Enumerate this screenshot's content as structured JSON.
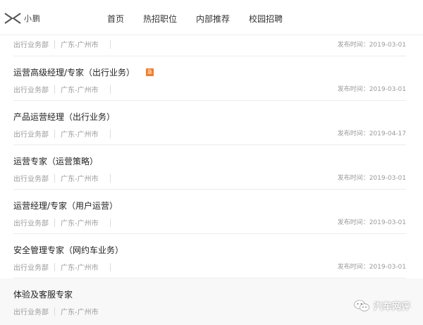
{
  "brand": {
    "name": "小鹏",
    "logo_icon": "xpeng-x-logo-icon"
  },
  "nav": [
    {
      "label": "首页"
    },
    {
      "label": "热招职位"
    },
    {
      "label": "内部推荐"
    },
    {
      "label": "校园招聘"
    }
  ],
  "jobs": [
    {
      "title": "",
      "dept": "出行业务部",
      "city": "广东-广州市",
      "date": "发布时间：2019-03-01",
      "hot": false
    },
    {
      "title": "运营高级经理/专家（出行业务）",
      "dept": "出行业务部",
      "city": "广东-广州市",
      "date": "发布时间：2019-03-01",
      "hot": true,
      "hot_label": "急"
    },
    {
      "title": "产品运营经理（出行业务）",
      "dept": "出行业务部",
      "city": "广东-广州市",
      "date": "发布时间：2019-04-17",
      "hot": false
    },
    {
      "title": "运营专家（运营策略）",
      "dept": "出行业务部",
      "city": "广东-广州市",
      "date": "发布时间：2019-03-01",
      "hot": false
    },
    {
      "title": "运营经理/专家（用户运营）",
      "dept": "出行业务部",
      "city": "广东-广州市",
      "date": "发布时间：2019-03-01",
      "hot": false
    },
    {
      "title": "安全管理专家（网约车业务）",
      "dept": "出行业务部",
      "city": "广东-广州市",
      "date": "发布时间：2019-03-01",
      "hot": false
    },
    {
      "title": "体验及客服专家",
      "dept": "出行业务部",
      "city": "广东-广州市",
      "date": "",
      "hot": false
    }
  ],
  "watermark": {
    "text": "汽车网评",
    "icon": "wechat-icon"
  },
  "colors": {
    "hot_badge": "#f07d28",
    "meta_text": "#9a9a9a",
    "divider": "#ececec"
  }
}
